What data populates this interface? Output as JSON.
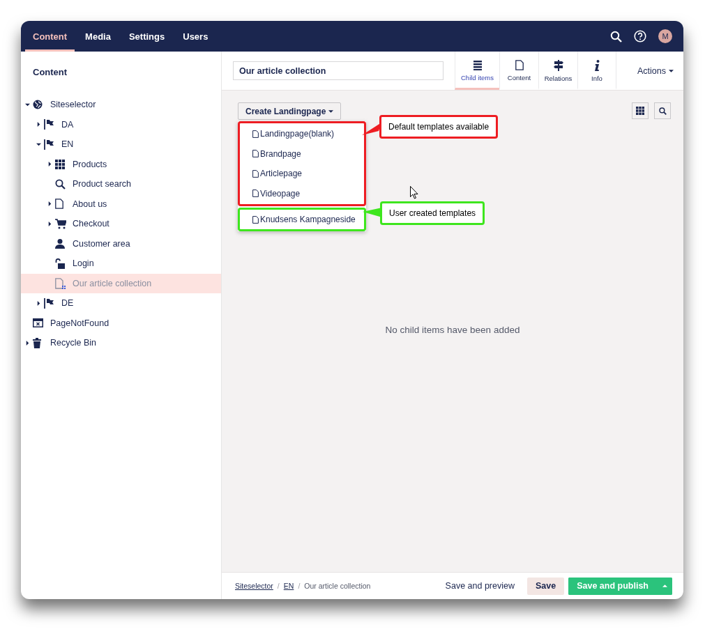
{
  "top_nav": {
    "sections": [
      {
        "label": "Content",
        "selected": true
      },
      {
        "label": "Media",
        "selected": false
      },
      {
        "label": "Settings",
        "selected": false
      },
      {
        "label": "Users",
        "selected": false
      }
    ],
    "avatar_initial": "M"
  },
  "sidebar": {
    "title": "Content",
    "tree": [
      {
        "label": "Siteselector",
        "kind": "globe",
        "expanded": true,
        "selected": false,
        "children": [
          {
            "label": "DA",
            "kind": "flag",
            "expanded": false,
            "selected": false
          },
          {
            "label": "EN",
            "kind": "flag",
            "expanded": true,
            "selected": false,
            "children": [
              {
                "label": "Products",
                "kind": "grid",
                "expanded": false,
                "selected": false
              },
              {
                "label": "Product search",
                "kind": "search",
                "selected": false
              },
              {
                "label": "About us",
                "kind": "page",
                "expanded": false,
                "selected": false
              },
              {
                "label": "Checkout",
                "kind": "cart",
                "expanded": false,
                "selected": false
              },
              {
                "label": "Customer area",
                "kind": "user",
                "selected": false
              },
              {
                "label": "Login",
                "kind": "lock",
                "selected": false
              },
              {
                "label": "Our article collection",
                "kind": "collection",
                "selected": true
              }
            ]
          },
          {
            "label": "DE",
            "kind": "flag",
            "expanded": false,
            "selected": false
          }
        ]
      },
      {
        "label": "PageNotFound",
        "kind": "notfound",
        "selected": false
      },
      {
        "label": "Recycle Bin",
        "kind": "trash",
        "expanded": false,
        "selected": false
      }
    ]
  },
  "editor": {
    "name_field": {
      "value": "Our article collection"
    },
    "apps": [
      {
        "label": "Child items",
        "kind": "list",
        "selected": true
      },
      {
        "label": "Content",
        "kind": "page",
        "selected": false
      },
      {
        "label": "Relations",
        "kind": "signpost",
        "selected": false
      },
      {
        "label": "Info",
        "kind": "info",
        "selected": false
      }
    ],
    "actions": "Actions",
    "create_button": "Create Landingpage",
    "template_groups": [
      {
        "color": "#ee1d23",
        "callout": "Default templates available",
        "items": [
          "Landingpage(blank)",
          "Brandpage",
          "Articlepage",
          "Videopage"
        ]
      },
      {
        "color": "#3ee61e",
        "callout": "User created templates",
        "items": [
          "Knudsens Kampagneside"
        ]
      }
    ],
    "empty_message": "No child items have been added"
  },
  "footer": {
    "breadcrumbs": [
      {
        "label": "Siteselector",
        "link": true
      },
      {
        "label": "EN",
        "link": true
      },
      {
        "label": "Our article collection",
        "link": false
      }
    ],
    "separator": "/",
    "save_preview": "Save and preview",
    "save": "Save",
    "publish": "Save and publish"
  }
}
